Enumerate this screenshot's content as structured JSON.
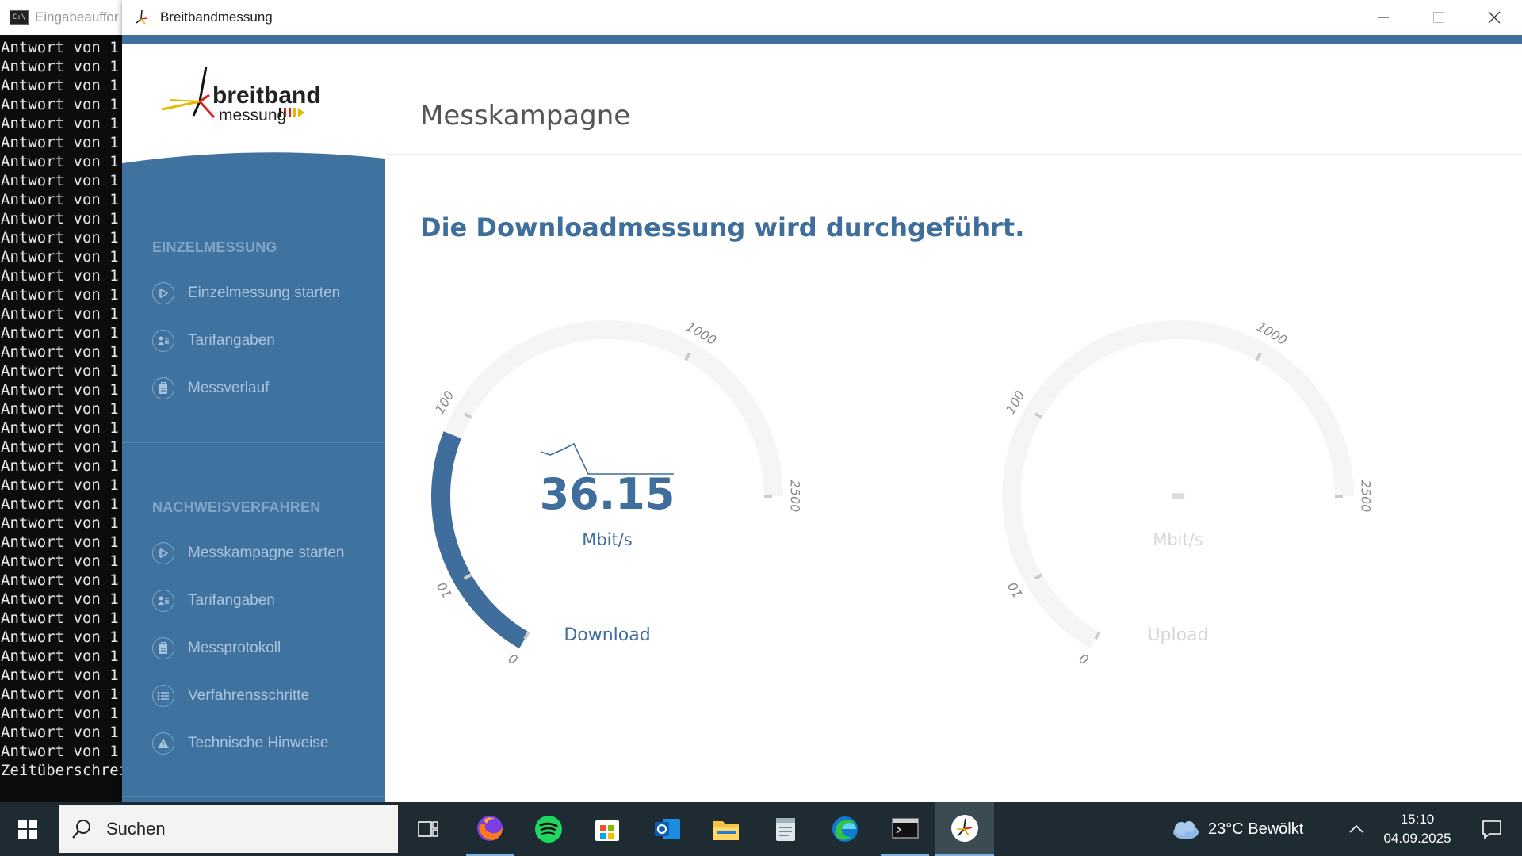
{
  "terminal": {
    "title": "Eingabeauffor",
    "line_text": "Antwort von 1.",
    "line_count": 38,
    "last_line": "Zeitüberschrei"
  },
  "window": {
    "title": "Breitbandmessung",
    "minimize_label": "─",
    "maximize_label": "☐",
    "close_label": "✕"
  },
  "logo": {
    "line1": "breitband",
    "line2": "messung"
  },
  "sidebar": {
    "section1": "EINZELMESSUNG",
    "section1_items": [
      {
        "label": "Einzelmessung starten",
        "icon": "play-icon"
      },
      {
        "label": "Tarifangaben",
        "icon": "user-list-icon"
      },
      {
        "label": "Messverlauf",
        "icon": "clipboard-icon"
      }
    ],
    "section2": "NACHWEISVERFAHREN",
    "section2_items": [
      {
        "label": "Messkampagne starten",
        "icon": "play-icon"
      },
      {
        "label": "Tarifangaben",
        "icon": "user-list-icon"
      },
      {
        "label": "Messprotokoll",
        "icon": "clipboard-icon"
      },
      {
        "label": "Verfahrensschritte",
        "icon": "list-icon"
      },
      {
        "label": "Technische Hinweise",
        "icon": "warning-icon"
      }
    ]
  },
  "page": {
    "title": "Messkampagne",
    "status": "Die Downloadmessung wird durchgeführt."
  },
  "gauges": {
    "download": {
      "value": "36.15",
      "unit": "Mbit/s",
      "label": "Download",
      "ticks": [
        "0",
        "10",
        "100",
        "1000",
        "2500"
      ],
      "fill_fraction": 0.34
    },
    "upload": {
      "value": "-",
      "unit": "Mbit/s",
      "label": "Upload",
      "ticks": [
        "0",
        "10",
        "100",
        "1000",
        "2500"
      ],
      "fill_fraction": 0
    }
  },
  "colors": {
    "accent": "#3f6e9c",
    "sidebar": "#40729f",
    "track": "#f5f5f5"
  },
  "taskbar": {
    "search_placeholder": "Suchen",
    "weather": "23°C  Bewölkt",
    "time": "15:10",
    "date": "04.09.2025",
    "apps": [
      "task-view-icon",
      "firefox-icon",
      "spotify-icon",
      "store-icon",
      "outlook-icon",
      "explorer-icon",
      "notepad-icon",
      "edge-icon",
      "terminal-icon",
      "breitband-icon"
    ]
  }
}
